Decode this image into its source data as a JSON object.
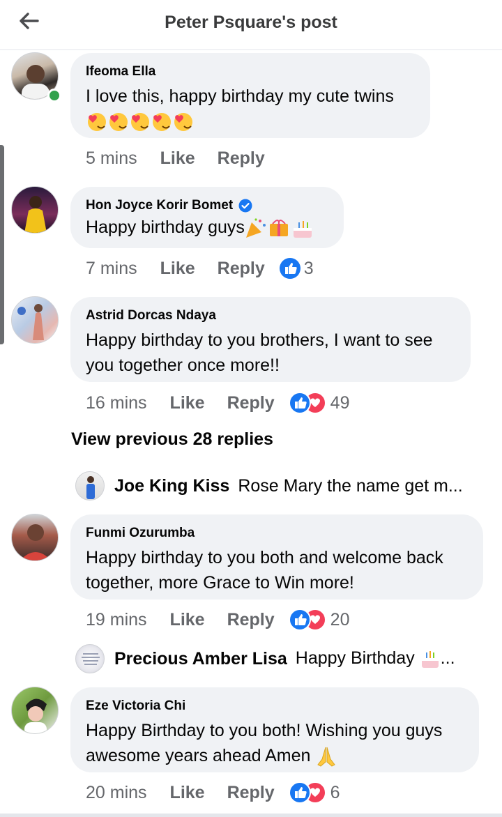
{
  "header": {
    "title": "Peter Psquare's post"
  },
  "comments": [
    {
      "author": "Ifeoma Ella",
      "text": "I love this, happy birthday my cute twins",
      "time": "5 mins",
      "like": "Like",
      "reply": "Reply",
      "reaction_count": ""
    },
    {
      "author": "Hon Joyce Korir Bomet",
      "text": "Happy birthday guys",
      "time": "7 mins",
      "like": "Like",
      "reply": "Reply",
      "reaction_count": "3"
    },
    {
      "author": "Astrid Dorcas Ndaya",
      "text": "Happy birthday to you brothers, I want to see you together once more!!",
      "time": "16 mins",
      "like": "Like",
      "reply": "Reply",
      "reaction_count": "49"
    },
    {
      "author": "Funmi Ozurumba",
      "text": "Happy birthday to you both and welcome back together, more Grace to Win more!",
      "time": "19 mins",
      "like": "Like",
      "reply": "Reply",
      "reaction_count": "20"
    },
    {
      "author": "Eze Victoria Chi",
      "text": "Happy Birthday to you both! Wishing you guys awesome years ahead Amen",
      "time": "20 mins",
      "like": "Like",
      "reply": "Reply",
      "reaction_count": "6"
    }
  ],
  "view_previous": "View previous 28 replies",
  "replies": [
    {
      "name": "Joe King Kiss",
      "text": "Rose Mary the name get m..."
    },
    {
      "name": "Precious Amber Lisa",
      "text": "Happy Birthday",
      "ellipsis": "..."
    }
  ],
  "colors": {
    "like_blue": "#1877f2",
    "love_red": "#f33e58",
    "online_green": "#31a24c",
    "bubble": "#f0f2f5"
  }
}
